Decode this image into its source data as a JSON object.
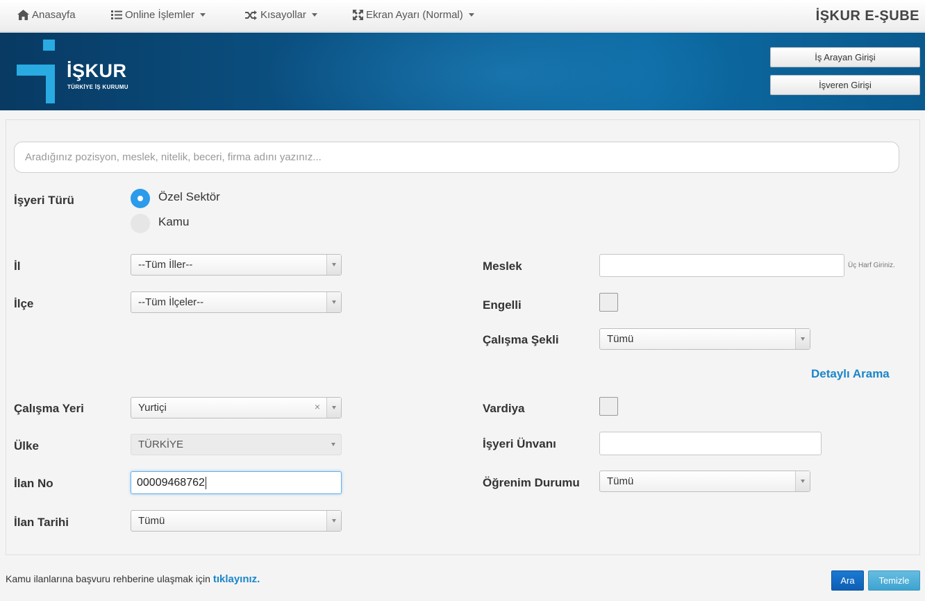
{
  "nav": {
    "home": "Anasayfa",
    "online": "Online İşlemler",
    "shortcuts": "Kısayollar",
    "screen": "Ekran Ayarı (Normal)",
    "brand": "İŞKUR E-ŞUBE"
  },
  "banner": {
    "logo_text": "İŞKUR",
    "logo_sub": "TÜRKİYE İŞ KURUMU",
    "seeker_login": "İş Arayan Girişi",
    "employer_login": "İşveren Girişi"
  },
  "search": {
    "placeholder": "Aradığınız pozisyon, meslek, nitelik, beceri, firma adını yazınız..."
  },
  "form": {
    "workplace_type_label": "İşyeri Türü",
    "workplace_options": [
      "Özel Sektör",
      "Kamu"
    ],
    "workplace_selected": "Özel Sektör",
    "province_label": "İl",
    "province_value": "--Tüm İller--",
    "district_label": "İlçe",
    "district_value": "--Tüm İlçeler--",
    "profession_label": "Meslek",
    "profession_value": "",
    "profession_hint": "Üç Harf Giriniz.",
    "disabled_label": "Engelli",
    "disabled_checked": false,
    "work_type_label": "Çalışma Şekli",
    "work_type_value": "Tümü",
    "detail_search": "Detaylı Arama",
    "work_place_label": "Çalışma Yeri",
    "work_place_value": "Yurtiçi",
    "clear_symbol": "×",
    "shift_label": "Vardiya",
    "shift_checked": false,
    "country_label": "Ülke",
    "country_value": "TÜRKİYE",
    "employer_title_label": "İşyeri Ünvanı",
    "employer_title_value": "",
    "ad_no_label": "İlan No",
    "ad_no_value": "00009468762",
    "education_label": "Öğrenim Durumu",
    "education_value": "Tümü",
    "ad_date_label": "İlan Tarihi",
    "ad_date_value": "Tümü"
  },
  "footer": {
    "guide_text": "Kamu ilanlarına başvuru rehberine ulaşmak için",
    "guide_link": "tıklayınız.",
    "search_button": "Ara",
    "clear_button": "Temizle"
  },
  "colors": {
    "accent": "#1a86c8",
    "radio_selected": "#2b9bea",
    "banner_dark": "#083a63",
    "banner_light": "#0c6aa3"
  }
}
